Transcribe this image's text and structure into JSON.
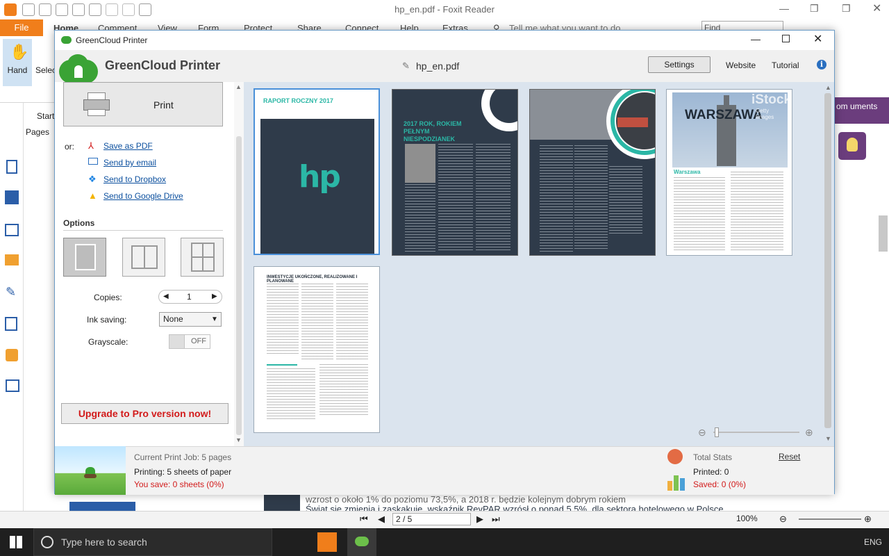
{
  "foxit": {
    "window_title": "hp_en.pdf - Foxit Reader",
    "file_tab": "File",
    "ribbon_tabs": [
      "Home",
      "Comment",
      "View",
      "Form",
      "Protect",
      "Share",
      "Connect",
      "Help",
      "Extras"
    ],
    "tell_me_placeholder": "Tell me what you want to do...",
    "find_placeholder": "Find",
    "hand_label": "Hand",
    "select_label": "Selec",
    "start_tab": "Start",
    "pages_label": "Pages",
    "purple_text": "om uments",
    "doc_text_line1": "wzrost o około 1% do poziomu 73,5%, a   2018 r. będzie kolejnym dobrym rokiem",
    "doc_text_line2": "Świat   się   zmienia   i   zaskakuje.   wskaźnik RevPAR wzrósł o ponad 5,5%.   dla   sektora   hotelowego   w   Polsce,",
    "page_indicator": "2 / 5",
    "zoom": "100%",
    "taskbar_search": "Type here to search",
    "taskbar_lang": "ENG"
  },
  "dialog": {
    "title": "GreenCloud Printer",
    "brand": "GreenCloud Printer",
    "filename": "hp_en.pdf",
    "settings_label": "Settings",
    "website_label": "Website",
    "tutorial_label": "Tutorial",
    "print_label": "Print",
    "or_label": "or:",
    "share": [
      {
        "label": "Save as PDF",
        "icon": "pdf-icon"
      },
      {
        "label": "Send by email",
        "icon": "email-icon"
      },
      {
        "label": "Send to Dropbox",
        "icon": "dropbox-icon"
      },
      {
        "label": "Send to Google Drive",
        "icon": "google-drive-icon"
      }
    ],
    "options_heading": "Options",
    "copies_label": "Copies:",
    "copies_value": "1",
    "ink_label": "Ink saving:",
    "ink_value": "None",
    "grayscale_label": "Grayscale:",
    "grayscale_value": "OFF",
    "upgrade_label": "Upgrade to Pro version now!",
    "pages": [
      {
        "title": "RAPORT ROCZNY 2017",
        "logo": "hp"
      },
      {
        "title": "2017 ROK, ROKIEM PEŁNYM NIESPODZIANEK"
      },
      {
        "title": ""
      },
      {
        "title": "WARSZAWA",
        "watermark": "iStock",
        "subtitle": "Warszawa",
        "watermark_sub": "Getty Images"
      },
      {
        "title": "INWESTYCJE UKOŃCZONE, REALIZOWANE I PLANOWANE"
      }
    ],
    "footer": {
      "job": "Current Print Job: 5 pages",
      "printing": "Printing: 5 sheets of paper",
      "save": "You save: 0 sheets (0%)",
      "total_stats": "Total Stats",
      "reset": "Reset",
      "printed": "Printed: 0",
      "saved": "Saved: 0 (0%)"
    },
    "colors": {
      "accent_green": "#3aa335",
      "teal": "#2bb7a6",
      "dark_slate": "#2f3b4a",
      "upgrade_red": "#d21b1b",
      "link_blue": "#0b4f9e"
    }
  }
}
